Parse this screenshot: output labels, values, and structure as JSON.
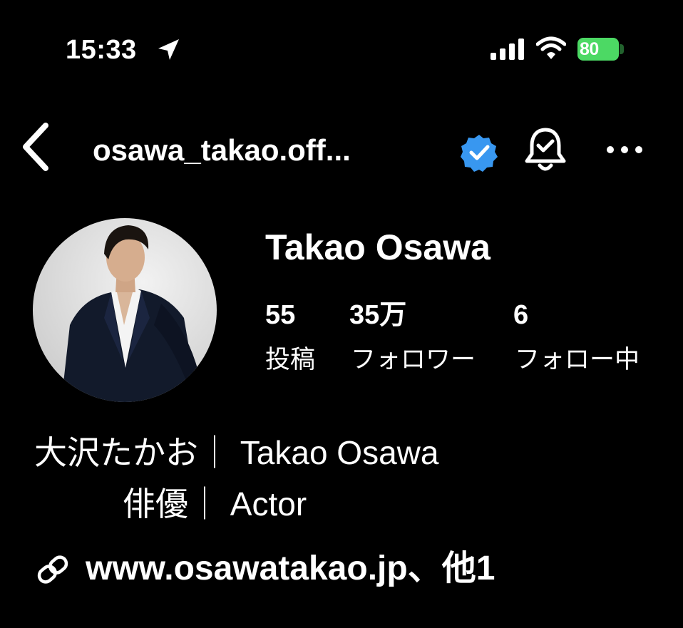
{
  "status_bar": {
    "time": "15:33",
    "battery": "80",
    "icons": [
      "location-arrow-icon",
      "signal-icon",
      "wifi-icon",
      "battery-icon"
    ]
  },
  "header": {
    "username": "osawa_takao.off...",
    "icons": [
      "back-icon",
      "verified-badge-icon",
      "notification-bell-icon",
      "more-icon"
    ],
    "verified_color": "#3897f0"
  },
  "profile": {
    "name": "Takao Osawa",
    "stats": [
      {
        "value": "55",
        "label": "投稿"
      },
      {
        "value": "35万",
        "label": "フォロワー"
      },
      {
        "value": "6",
        "label": "フォロー中"
      }
    ]
  },
  "bio": {
    "line1": "大沢たかお｜ Takao Osawa",
    "line2": "俳優｜ Actor",
    "link": "www.osawatakao.jp、他1"
  },
  "colors": {
    "background": "#000000",
    "text": "#ffffff",
    "battery": "#4cd964"
  }
}
